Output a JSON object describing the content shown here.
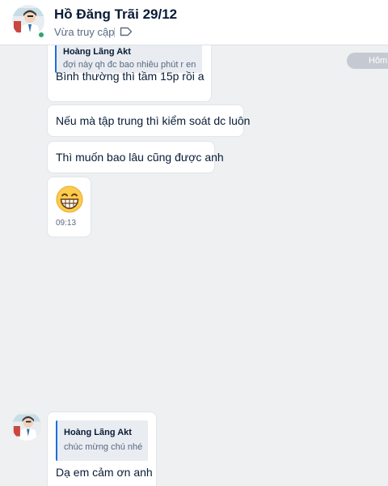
{
  "header": {
    "contact_name": "Hồ Đăng Trãi 29/12",
    "status": "Vừa truy cập"
  },
  "chat": {
    "date_pill": "Hôm nay",
    "messages": [
      {
        "quote": {
          "author": "Hoàng Lãng Akt",
          "text": "đợi này qh đc bao nhiêu phút r en"
        },
        "text": "Bình thường thì tầm 15p rồi a"
      },
      {
        "text": "Nếu mà tập trung thì kiểm soát dc luôn"
      },
      {
        "text": "Thì muốn bao lâu cũng được anh"
      },
      {
        "emoji": "grinning-face-emoji",
        "time": "09:13"
      },
      {
        "quote": {
          "author": "Hoàng Lãng Akt",
          "text": "chúc mừng chú nhé"
        },
        "text": "Dạ em cảm ơn anh"
      }
    ]
  },
  "colors": {
    "chat_background": "#eef0f1",
    "bubble": "#ffffff",
    "quote_bar": "#1a6fd8",
    "online": "#30a46c"
  },
  "icons": [
    "avatar-illustration",
    "tag-icon",
    "grinning-face-emoji"
  ]
}
